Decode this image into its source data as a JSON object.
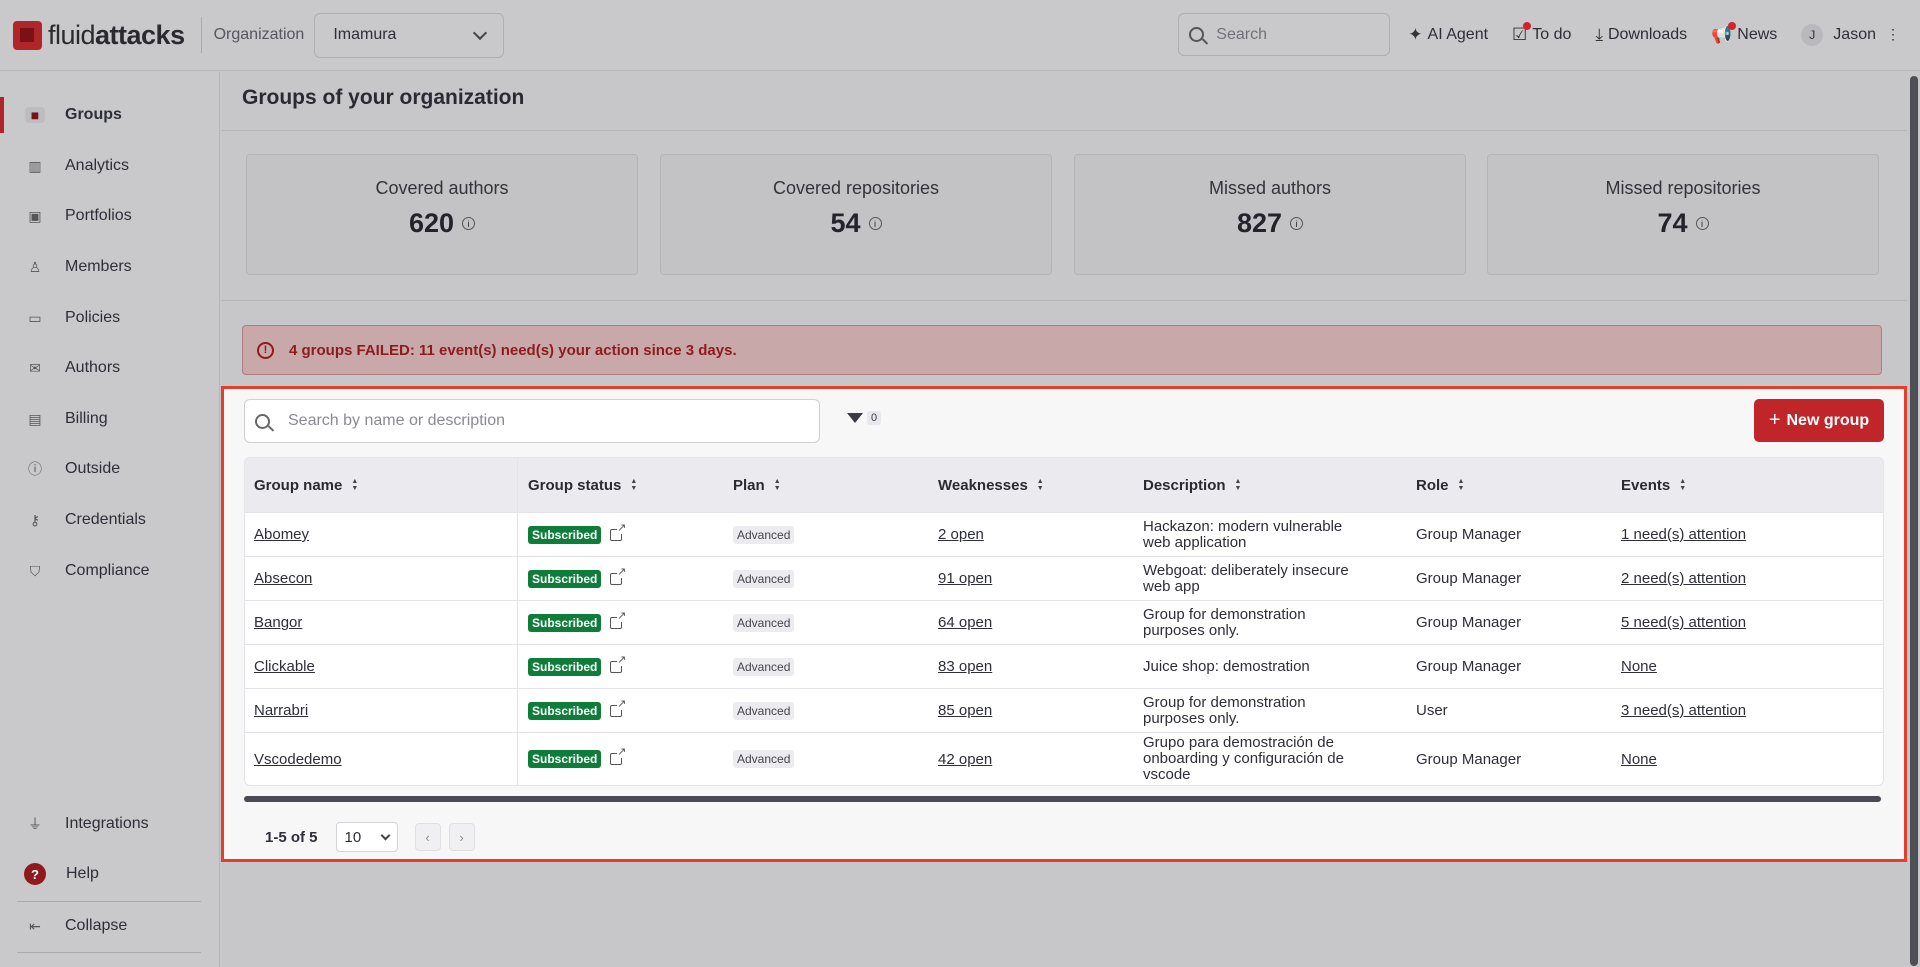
{
  "topbar": {
    "logo_light": "fluid",
    "logo_bold": "attacks",
    "org_label": "Organization",
    "org_value": "Imamura",
    "search_placeholder": "Search",
    "ai_agent": "AI Agent",
    "todo": "To do",
    "downloads": "Downloads",
    "news": "News",
    "user_initial": "J",
    "user_name": "Jason"
  },
  "sidebar": {
    "items": [
      {
        "label": "Groups",
        "icon": "folder-icon"
      },
      {
        "label": "Analytics",
        "icon": "bar-chart-icon"
      },
      {
        "label": "Portfolios",
        "icon": "briefcase-icon"
      },
      {
        "label": "Members",
        "icon": "user-plus-icon"
      },
      {
        "label": "Policies",
        "icon": "folder-check-icon"
      },
      {
        "label": "Authors",
        "icon": "mail-icon"
      },
      {
        "label": "Billing",
        "icon": "credit-card-icon"
      },
      {
        "label": "Outside",
        "icon": "info-circle-icon"
      },
      {
        "label": "Credentials",
        "icon": "key-icon"
      },
      {
        "label": "Compliance",
        "icon": "shield-check-icon"
      }
    ],
    "integrations": "Integrations",
    "help": "Help",
    "collapse": "Collapse"
  },
  "main": {
    "title": "Groups of your organization",
    "cards": [
      {
        "label": "Covered authors",
        "value": "620"
      },
      {
        "label": "Covered repositories",
        "value": "54"
      },
      {
        "label": "Missed authors",
        "value": "827"
      },
      {
        "label": "Missed repositories",
        "value": "74"
      }
    ],
    "alert": "4 groups FAILED: 11 event(s) need(s) your action since 3 days."
  },
  "panel": {
    "search_placeholder": "Search by name or description",
    "filter_count": "0",
    "new_group": "New group",
    "columns": [
      "Group name",
      "Group status",
      "Plan",
      "Weaknesses",
      "Description",
      "Role",
      "Events"
    ],
    "rows": [
      {
        "name": "Abomey",
        "status": "Subscribed",
        "plan": "Advanced",
        "weaknesses": "2 open",
        "description": "Hackazon: modern vulnerable web application",
        "role": "Group Manager",
        "events": "1 need(s) attention"
      },
      {
        "name": "Absecon",
        "status": "Subscribed",
        "plan": "Advanced",
        "weaknesses": "91 open",
        "description": "Webgoat: deliberately insecure web app",
        "role": "Group Manager",
        "events": "2 need(s) attention"
      },
      {
        "name": "Bangor",
        "status": "Subscribed",
        "plan": "Advanced",
        "weaknesses": "64 open",
        "description": "Group for demonstration purposes only.",
        "role": "Group Manager",
        "events": "5 need(s) attention"
      },
      {
        "name": "Clickable",
        "status": "Subscribed",
        "plan": "Advanced",
        "weaknesses": "83 open",
        "description": "Juice shop: demostration",
        "role": "Group Manager",
        "events": "None"
      },
      {
        "name": "Narrabri",
        "status": "Subscribed",
        "plan": "Advanced",
        "weaknesses": "85 open",
        "description": "Group for demonstration purposes only.",
        "role": "User",
        "events": "3 need(s) attention"
      },
      {
        "name": "Vscodedemo",
        "status": "Subscribed",
        "plan": "Advanced",
        "weaknesses": "42 open",
        "description": "Grupo para demostración de onboarding y configuración de vscode",
        "role": "Group Manager",
        "events": "None"
      }
    ],
    "pager_range": "1-5 of 5",
    "per_page": "10"
  },
  "colors": {
    "brand": "#b0252a",
    "button": "#bf2529",
    "subscribed": "#0f7d3a",
    "highlight_border": "#e2402c"
  }
}
